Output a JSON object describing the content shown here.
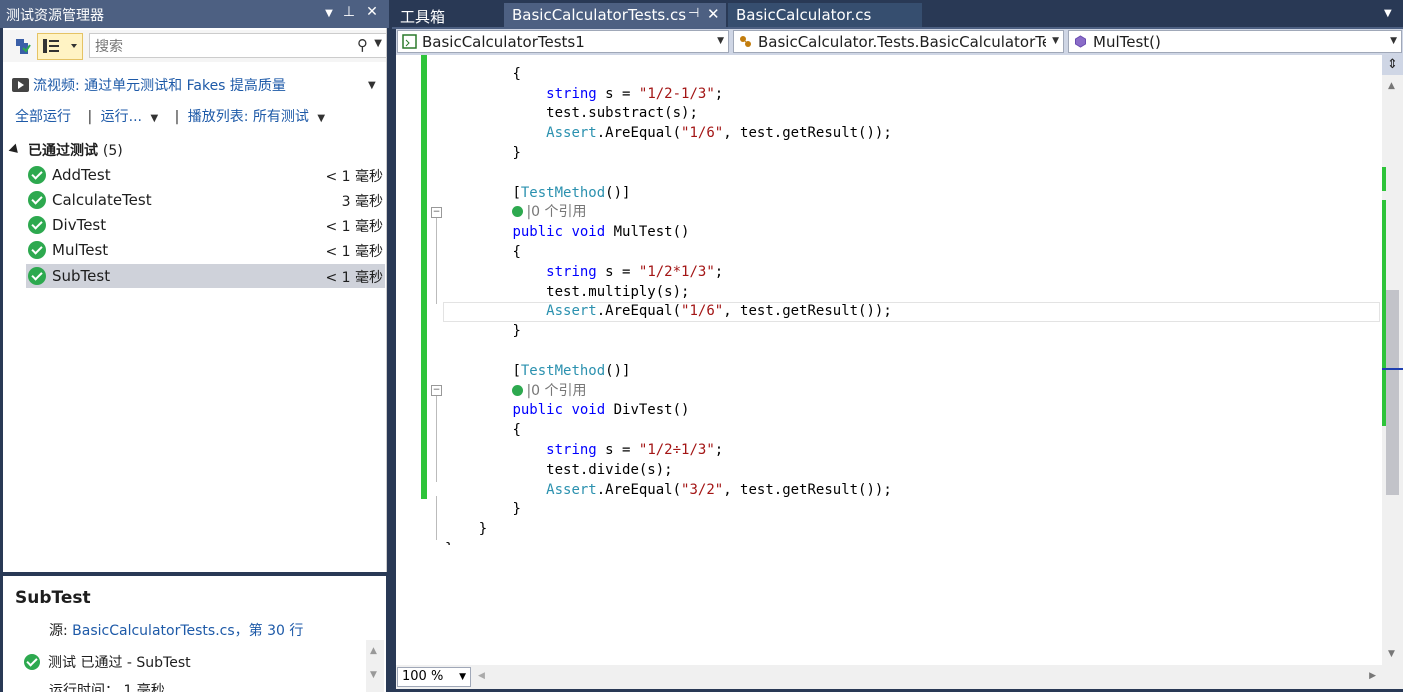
{
  "left_panel": {
    "title": "测试资源管理器",
    "title_dd": "▼",
    "pin": "⊥",
    "close": "✕",
    "search_placeholder": "搜索",
    "video_link": "流视频: 通过单元测试和 Fakes 提高质量",
    "actions": {
      "run_all": "全部运行",
      "run": "运行...",
      "playlist": "播放列表: 所有测试"
    },
    "group": {
      "label": "已通过测试",
      "count": "(5)"
    },
    "tests": [
      {
        "name": "AddTest",
        "time": "< 1 毫秒"
      },
      {
        "name": "CalculateTest",
        "time": "3 毫秒"
      },
      {
        "name": "DivTest",
        "time": "< 1 毫秒"
      },
      {
        "name": "MulTest",
        "time": "< 1 毫秒"
      },
      {
        "name": "SubTest",
        "time": "< 1 毫秒"
      }
    ],
    "detail": {
      "title": "SubTest",
      "source_label": "源:",
      "source_link": "BasicCalculatorTests.cs，第 30 行",
      "status": "测试 已通过 - SubTest",
      "runtime": "运行时间：   1 毫秒"
    }
  },
  "tabs": {
    "toolbox": "工具箱",
    "active": "BasicCalculatorTests.cs",
    "other": "BasicCalculator.cs"
  },
  "navbar": {
    "project": "BasicCalculatorTests1",
    "class": "BasicCalculator.Tests.BasicCalculatorTes",
    "member": "MulTest()"
  },
  "code": {
    "open_brace": "{",
    "close_brace": "}",
    "string_kw": "string",
    "s_eq": " s = ",
    "sub_str": "\"1/2-1/3\"",
    "mul_str": "\"1/2*1/3\"",
    "div_str": "\"1/2÷1/3\"",
    "semi": ";",
    "sub_call": "test.substract(s);",
    "mul_call": "test.multiply(s);",
    "div_call": "test.divide(s);",
    "assert": "Assert",
    "are_equal": ".AreEqual(",
    "res_16": "\"1/6\"",
    "res_32": "\"3/2\"",
    "get_result": ", test.getResult());",
    "attr_open": "[",
    "test_method": "TestMethod",
    "attr_close": "()]",
    "refs": "|0 个引用",
    "public_void": "public void",
    "mul_name": " MulTest()",
    "div_name": " DivTest()"
  },
  "status": {
    "zoom": "100 %"
  }
}
